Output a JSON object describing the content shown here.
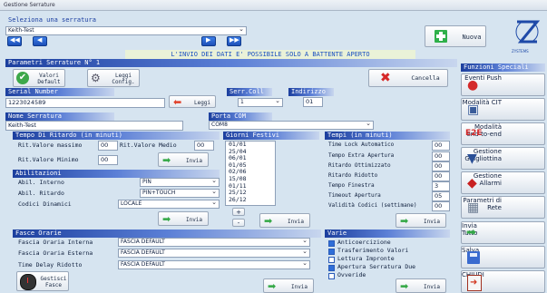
{
  "window": {
    "title": "Gestione Serrature"
  },
  "select_lock": {
    "section": "Seleziona una serratura",
    "value": "Keith-Test",
    "new_button": "Nuova"
  },
  "banner": "L'INVIO DEI DATI E' POSSIBILE SOLO A BATTENTE APERTO",
  "params": {
    "section": "Parametri Serrature N° 1",
    "default_button": "Valori Default",
    "read_button": "Leggi Config.",
    "cancel_button": "Cancella",
    "serial_label": "Serial Number",
    "serial_value": "1223024589",
    "read_short": "Leggi",
    "coll_label": "Serr.Coll",
    "coll_value": "1",
    "address_label": "Indirizzo",
    "address_value": "01",
    "name_label": "Nome Serratura",
    "name_value": "Keith-Test",
    "port_label": "Porta COM",
    "port_value": "COM8"
  },
  "delay": {
    "section": "Tempo Di Ritardo (in minuti)",
    "max_label": "Rit.Valore massimo",
    "max_value": "00",
    "mid_label": "Rit.Valore Medio",
    "mid_value": "00",
    "min_label": "Rit.Valore Minimo",
    "min_value": "00",
    "send": "Invia"
  },
  "holidays": {
    "section": "Giorni Festivi",
    "items": [
      "01/01",
      "25/04",
      "06/01",
      "01/05",
      "02/06",
      "15/08",
      "01/11",
      "25/12",
      "26/12"
    ],
    "plus": "+",
    "minus": "-",
    "send": "Invia"
  },
  "times": {
    "section": "Tempi (in minuti)",
    "rows": [
      {
        "label": "Time Lock Automatico",
        "value": "00"
      },
      {
        "label": "Tempo Extra Apertura",
        "value": "00"
      },
      {
        "label": "Ritardo Ottimizzato",
        "value": "00"
      },
      {
        "label": "Ritardo Ridotto",
        "value": "00"
      },
      {
        "label": "Tempo Finestra",
        "value": "3"
      },
      {
        "label": "Timeout Apertura",
        "value": "05"
      },
      {
        "label": "Validità Codici (settimane)",
        "value": "00"
      }
    ],
    "send": "Invia"
  },
  "enable": {
    "section": "Abilitazioni",
    "internal_label": "Abil. Interno",
    "internal_value": "PIN",
    "delay_label": "Abil. Ritardo",
    "delay_value": "PIN+TOUCH",
    "dynamic_label": "Codici Dinamici",
    "dynamic_value": "LOCALE",
    "send": "Invia"
  },
  "bands": {
    "section": "Fasce Orarie",
    "internal_label": "Fascia Oraria Interna",
    "internal_value": "FASCIA DEFAULT",
    "external_label": "Fascia Oraria Esterna",
    "external_value": "FASCIA DEFAULT",
    "delay_label": "Time Delay Ridotto",
    "delay_value": "FASCIA DEFAULT",
    "manage_button": "Gestisci Fasce",
    "send": "Invia"
  },
  "various": {
    "section": "Varie",
    "options": [
      {
        "label": "Anticoercizione",
        "checked": true
      },
      {
        "label": "Trasferimento Valori",
        "checked": true
      },
      {
        "label": "Lettura Impronte",
        "checked": false
      },
      {
        "label": "Apertura Serratura Due",
        "checked": true
      },
      {
        "label": "Ovveride",
        "checked": false
      }
    ],
    "send": "Invia"
  },
  "special": {
    "section": "Funzioni Speciali",
    "buttons": [
      "Eventi Push",
      "Modalità CIT",
      "Modalità end-to-end",
      "Gestione Ghigliottina",
      "Gestione Allarmi",
      "Parametri di Rete"
    ],
    "e2e_badge": "E2E"
  },
  "actions": {
    "send_all": "Invia Tutto",
    "save": "Salva",
    "close": "CHIUDI"
  },
  "logo_text": "ZYSTEMS"
}
